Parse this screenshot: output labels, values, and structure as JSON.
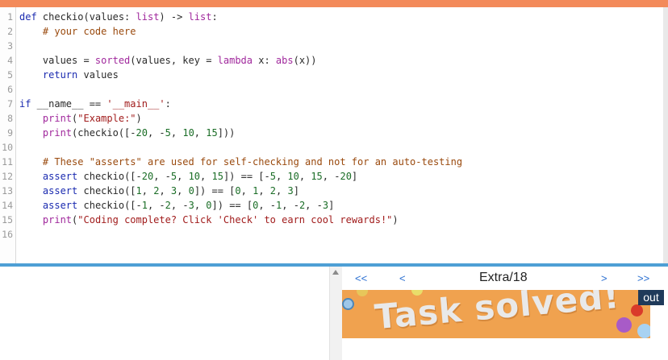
{
  "editor": {
    "lines": [
      {
        "num": "1",
        "tokens": [
          {
            "t": "def ",
            "c": "kw"
          },
          {
            "t": "checkio",
            "c": "fn"
          },
          {
            "t": "(values: ",
            "c": "tx"
          },
          {
            "t": "list",
            "c": "bi"
          },
          {
            "t": ") -> ",
            "c": "tx"
          },
          {
            "t": "list",
            "c": "bi"
          },
          {
            "t": ":",
            "c": "tx"
          }
        ]
      },
      {
        "num": "2",
        "tokens": [
          {
            "t": "    ",
            "c": "tx"
          },
          {
            "t": "# your code here",
            "c": "cm"
          }
        ]
      },
      {
        "num": "3",
        "tokens": []
      },
      {
        "num": "4",
        "tokens": [
          {
            "t": "    values = ",
            "c": "tx"
          },
          {
            "t": "sorted",
            "c": "bi"
          },
          {
            "t": "(values, key = ",
            "c": "tx"
          },
          {
            "t": "lambda",
            "c": "bi"
          },
          {
            "t": " x: ",
            "c": "tx"
          },
          {
            "t": "abs",
            "c": "bi"
          },
          {
            "t": "(x))",
            "c": "tx"
          }
        ]
      },
      {
        "num": "5",
        "tokens": [
          {
            "t": "    ",
            "c": "tx"
          },
          {
            "t": "return",
            "c": "kw"
          },
          {
            "t": " values",
            "c": "tx"
          }
        ]
      },
      {
        "num": "6",
        "tokens": []
      },
      {
        "num": "7",
        "tokens": [
          {
            "t": "if",
            "c": "kw"
          },
          {
            "t": " __name__ == ",
            "c": "tx"
          },
          {
            "t": "'__main__'",
            "c": "st"
          },
          {
            "t": ":",
            "c": "tx"
          }
        ]
      },
      {
        "num": "8",
        "tokens": [
          {
            "t": "    ",
            "c": "tx"
          },
          {
            "t": "print",
            "c": "bi"
          },
          {
            "t": "(",
            "c": "tx"
          },
          {
            "t": "\"Example:\"",
            "c": "st"
          },
          {
            "t": ")",
            "c": "tx"
          }
        ]
      },
      {
        "num": "9",
        "tokens": [
          {
            "t": "    ",
            "c": "tx"
          },
          {
            "t": "print",
            "c": "bi"
          },
          {
            "t": "(checkio([-",
            "c": "tx"
          },
          {
            "t": "20",
            "c": "nu"
          },
          {
            "t": ", -",
            "c": "tx"
          },
          {
            "t": "5",
            "c": "nu"
          },
          {
            "t": ", ",
            "c": "tx"
          },
          {
            "t": "10",
            "c": "nu"
          },
          {
            "t": ", ",
            "c": "tx"
          },
          {
            "t": "15",
            "c": "nu"
          },
          {
            "t": "]))",
            "c": "tx"
          }
        ]
      },
      {
        "num": "10",
        "tokens": []
      },
      {
        "num": "11",
        "tokens": [
          {
            "t": "    ",
            "c": "tx"
          },
          {
            "t": "# These \"asserts\" are used for self-checking and not for an auto-testing",
            "c": "cm"
          }
        ]
      },
      {
        "num": "12",
        "tokens": [
          {
            "t": "    ",
            "c": "tx"
          },
          {
            "t": "assert",
            "c": "kw"
          },
          {
            "t": " checkio([-",
            "c": "tx"
          },
          {
            "t": "20",
            "c": "nu"
          },
          {
            "t": ", -",
            "c": "tx"
          },
          {
            "t": "5",
            "c": "nu"
          },
          {
            "t": ", ",
            "c": "tx"
          },
          {
            "t": "10",
            "c": "nu"
          },
          {
            "t": ", ",
            "c": "tx"
          },
          {
            "t": "15",
            "c": "nu"
          },
          {
            "t": "]) == [-",
            "c": "tx"
          },
          {
            "t": "5",
            "c": "nu"
          },
          {
            "t": ", ",
            "c": "tx"
          },
          {
            "t": "10",
            "c": "nu"
          },
          {
            "t": ", ",
            "c": "tx"
          },
          {
            "t": "15",
            "c": "nu"
          },
          {
            "t": ", -",
            "c": "tx"
          },
          {
            "t": "20",
            "c": "nu"
          },
          {
            "t": "]",
            "c": "tx"
          }
        ]
      },
      {
        "num": "13",
        "tokens": [
          {
            "t": "    ",
            "c": "tx"
          },
          {
            "t": "assert",
            "c": "kw"
          },
          {
            "t": " checkio([",
            "c": "tx"
          },
          {
            "t": "1",
            "c": "nu"
          },
          {
            "t": ", ",
            "c": "tx"
          },
          {
            "t": "2",
            "c": "nu"
          },
          {
            "t": ", ",
            "c": "tx"
          },
          {
            "t": "3",
            "c": "nu"
          },
          {
            "t": ", ",
            "c": "tx"
          },
          {
            "t": "0",
            "c": "nu"
          },
          {
            "t": "]) == [",
            "c": "tx"
          },
          {
            "t": "0",
            "c": "nu"
          },
          {
            "t": ", ",
            "c": "tx"
          },
          {
            "t": "1",
            "c": "nu"
          },
          {
            "t": ", ",
            "c": "tx"
          },
          {
            "t": "2",
            "c": "nu"
          },
          {
            "t": ", ",
            "c": "tx"
          },
          {
            "t": "3",
            "c": "nu"
          },
          {
            "t": "]",
            "c": "tx"
          }
        ]
      },
      {
        "num": "14",
        "tokens": [
          {
            "t": "    ",
            "c": "tx"
          },
          {
            "t": "assert",
            "c": "kw"
          },
          {
            "t": " checkio([-",
            "c": "tx"
          },
          {
            "t": "1",
            "c": "nu"
          },
          {
            "t": ", -",
            "c": "tx"
          },
          {
            "t": "2",
            "c": "nu"
          },
          {
            "t": ", -",
            "c": "tx"
          },
          {
            "t": "3",
            "c": "nu"
          },
          {
            "t": ", ",
            "c": "tx"
          },
          {
            "t": "0",
            "c": "nu"
          },
          {
            "t": "]) == [",
            "c": "tx"
          },
          {
            "t": "0",
            "c": "nu"
          },
          {
            "t": ", -",
            "c": "tx"
          },
          {
            "t": "1",
            "c": "nu"
          },
          {
            "t": ", -",
            "c": "tx"
          },
          {
            "t": "2",
            "c": "nu"
          },
          {
            "t": ", -",
            "c": "tx"
          },
          {
            "t": "3",
            "c": "nu"
          },
          {
            "t": "]",
            "c": "tx"
          }
        ]
      },
      {
        "num": "15",
        "tokens": [
          {
            "t": "    ",
            "c": "tx"
          },
          {
            "t": "print",
            "c": "bi"
          },
          {
            "t": "(",
            "c": "tx"
          },
          {
            "t": "\"Coding complete? Click 'Check' to earn cool rewards!\"",
            "c": "st"
          },
          {
            "t": ")",
            "c": "tx"
          }
        ]
      },
      {
        "num": "16",
        "tokens": []
      }
    ]
  },
  "nav": {
    "first_label": "<<",
    "prev_label": "<",
    "title": "Extra/18",
    "next_label": ">",
    "last_label": ">>"
  },
  "banner": {
    "text": "Task solved!",
    "balls": [
      {
        "color": "#9ec7e8"
      },
      {
        "color": "#e9dd6a"
      },
      {
        "color": "#d93a2a"
      },
      {
        "color": "#a85bc7"
      },
      {
        "color": "#a8d2f2"
      },
      {
        "color": "#e7c65a"
      }
    ]
  },
  "out_button": {
    "label": "out"
  },
  "colors": {
    "top_strip": "#f38a5a",
    "divider": "#4e9fd5",
    "banner": "#f0a24f",
    "out_button": "#1f3a5a"
  }
}
